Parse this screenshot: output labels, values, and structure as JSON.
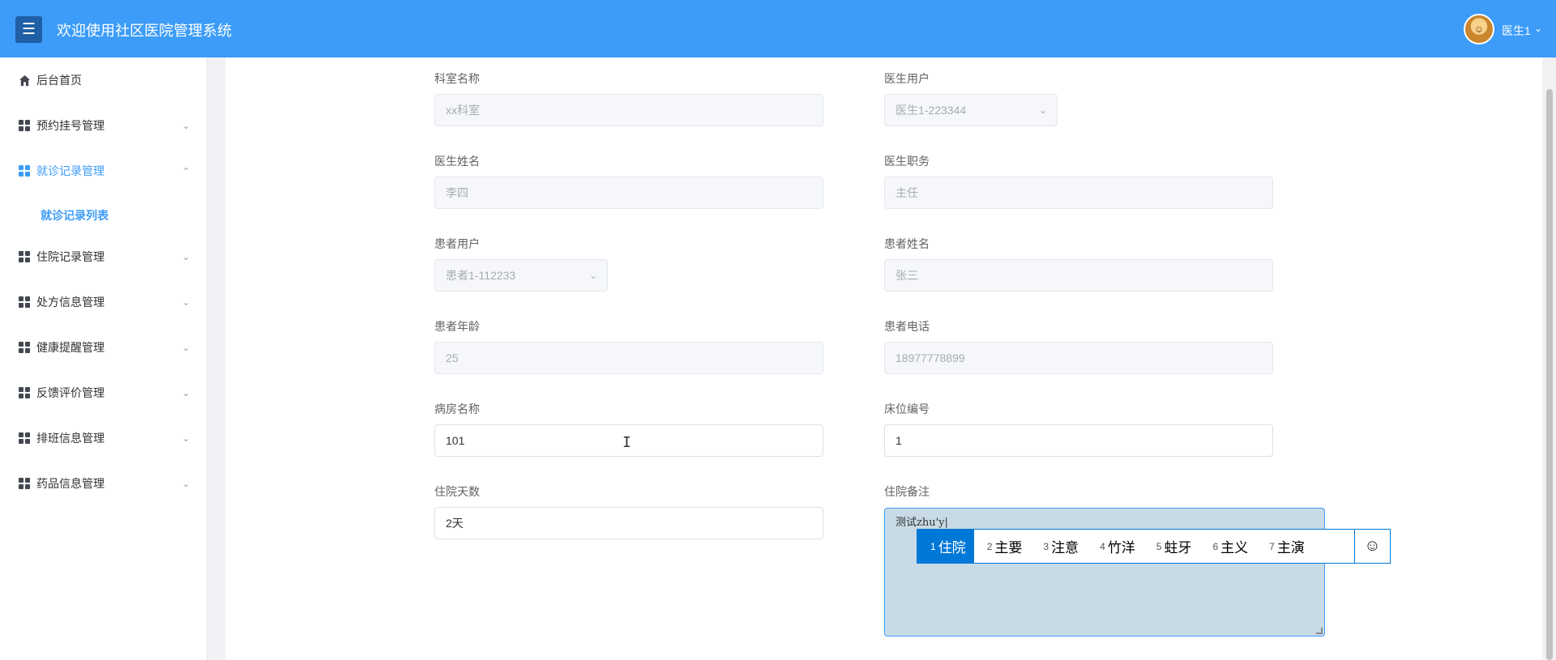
{
  "header": {
    "menu_icon": "hamburger-icon",
    "title": "欢迎使用社区医院管理系统",
    "user": {
      "avatar_icon": "avatar-cartoon",
      "name": "医生1",
      "chevron": "chevron-down-icon"
    }
  },
  "sidebar": {
    "items": [
      {
        "label": "后台首页",
        "icon": "home-icon",
        "chevron": ""
      },
      {
        "label": "预约挂号管理",
        "icon": "grid-icon",
        "chevron": "⌄"
      },
      {
        "label": "就诊记录管理",
        "icon": "grid-icon",
        "chevron": "⌃",
        "active": true
      },
      {
        "label": "住院记录管理",
        "icon": "grid-icon",
        "chevron": "⌄"
      },
      {
        "label": "处方信息管理",
        "icon": "grid-icon",
        "chevron": "⌄"
      },
      {
        "label": "健康提醒管理",
        "icon": "grid-icon",
        "chevron": "⌄"
      },
      {
        "label": "反馈评价管理",
        "icon": "grid-icon",
        "chevron": "⌄"
      },
      {
        "label": "排班信息管理",
        "icon": "grid-icon",
        "chevron": "⌄"
      },
      {
        "label": "药品信息管理",
        "icon": "grid-icon",
        "chevron": "⌄"
      }
    ],
    "subitem": "就诊记录列表"
  },
  "form": {
    "department_name": {
      "label": "科室名称",
      "value": "xx科室"
    },
    "doctor_user": {
      "label": "医生用户",
      "value": "医生1-223344"
    },
    "doctor_name": {
      "label": "医生姓名",
      "value": "李四"
    },
    "doctor_title": {
      "label": "医生职务",
      "value": "主任"
    },
    "patient_user": {
      "label": "患者用户",
      "value": "患者1-112233"
    },
    "patient_name": {
      "label": "患者姓名",
      "value": "张三"
    },
    "patient_age": {
      "label": "患者年龄",
      "value": "25"
    },
    "patient_phone": {
      "label": "患者电话",
      "value": "18977778899"
    },
    "ward_name": {
      "label": "病房名称",
      "value": "101"
    },
    "bed_number": {
      "label": "床位编号",
      "value": "1"
    },
    "stay_days": {
      "label": "住院天数",
      "value": "2天"
    },
    "stay_notes": {
      "label": "住院备注",
      "value": "测试zhu'y|"
    }
  },
  "ime": {
    "candidates": [
      {
        "n": "1",
        "text": "住院"
      },
      {
        "n": "2",
        "text": "主要"
      },
      {
        "n": "3",
        "text": "注意"
      },
      {
        "n": "4",
        "text": "竹洋"
      },
      {
        "n": "5",
        "text": "蛀牙"
      },
      {
        "n": "6",
        "text": "主义"
      },
      {
        "n": "7",
        "text": "主演"
      }
    ],
    "emoji_glyph": "☺"
  },
  "colors": {
    "header": "#3c9cf8",
    "accent": "#409eff",
    "ime_select": "#0078d7"
  }
}
